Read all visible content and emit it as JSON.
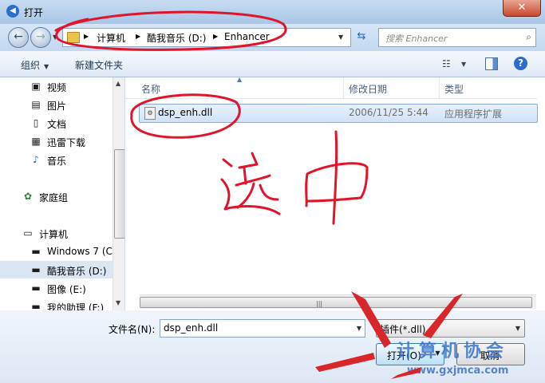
{
  "window": {
    "title": "打开",
    "close_label": "✕"
  },
  "nav": {
    "back_icon": "back-arrow",
    "forward_icon": "forward-arrow",
    "breadcrumbs": [
      "计算机",
      "酷我音乐 (D:)",
      "Enhancer"
    ],
    "search_placeholder": "搜索 Enhancer"
  },
  "toolbar": {
    "organize_label": "组织",
    "new_folder_label": "新建文件夹"
  },
  "sidebar": {
    "items": [
      {
        "label": "视频",
        "icon": "video-icon"
      },
      {
        "label": "图片",
        "icon": "picture-icon"
      },
      {
        "label": "文档",
        "icon": "document-icon"
      },
      {
        "label": "迅雷下载",
        "icon": "download-icon"
      },
      {
        "label": "音乐",
        "icon": "music-icon"
      },
      {
        "label": "家庭组",
        "icon": "homegroup-icon"
      },
      {
        "label": "计算机",
        "icon": "computer-icon"
      },
      {
        "label": "Windows 7 (C",
        "icon": "drive-icon"
      },
      {
        "label": "酷我音乐 (D:)",
        "icon": "drive-icon",
        "selected": true
      },
      {
        "label": "图像 (E:)",
        "icon": "drive-icon"
      },
      {
        "label": "我的助理 (F:)",
        "icon": "drive-icon"
      }
    ]
  },
  "file_list": {
    "columns": [
      "名称",
      "修改日期",
      "类型"
    ],
    "rows": [
      {
        "name": "dsp_enh.dll",
        "date": "2006/11/25 5:44",
        "type": "应用程序扩展"
      }
    ]
  },
  "bottom": {
    "filename_label": "文件名(N):",
    "filename_value": "dsp_enh.dll",
    "filter_value": "插件(*.dll)",
    "open_label": "打开(O)",
    "cancel_label": "取消"
  },
  "annotations": {
    "handwritten_note": "选中",
    "watermark_text": "计算机协会",
    "watermark_url": "www.gxjmca.com",
    "ink_color": "#e0142a",
    "arrow_color": "#d8262a"
  }
}
